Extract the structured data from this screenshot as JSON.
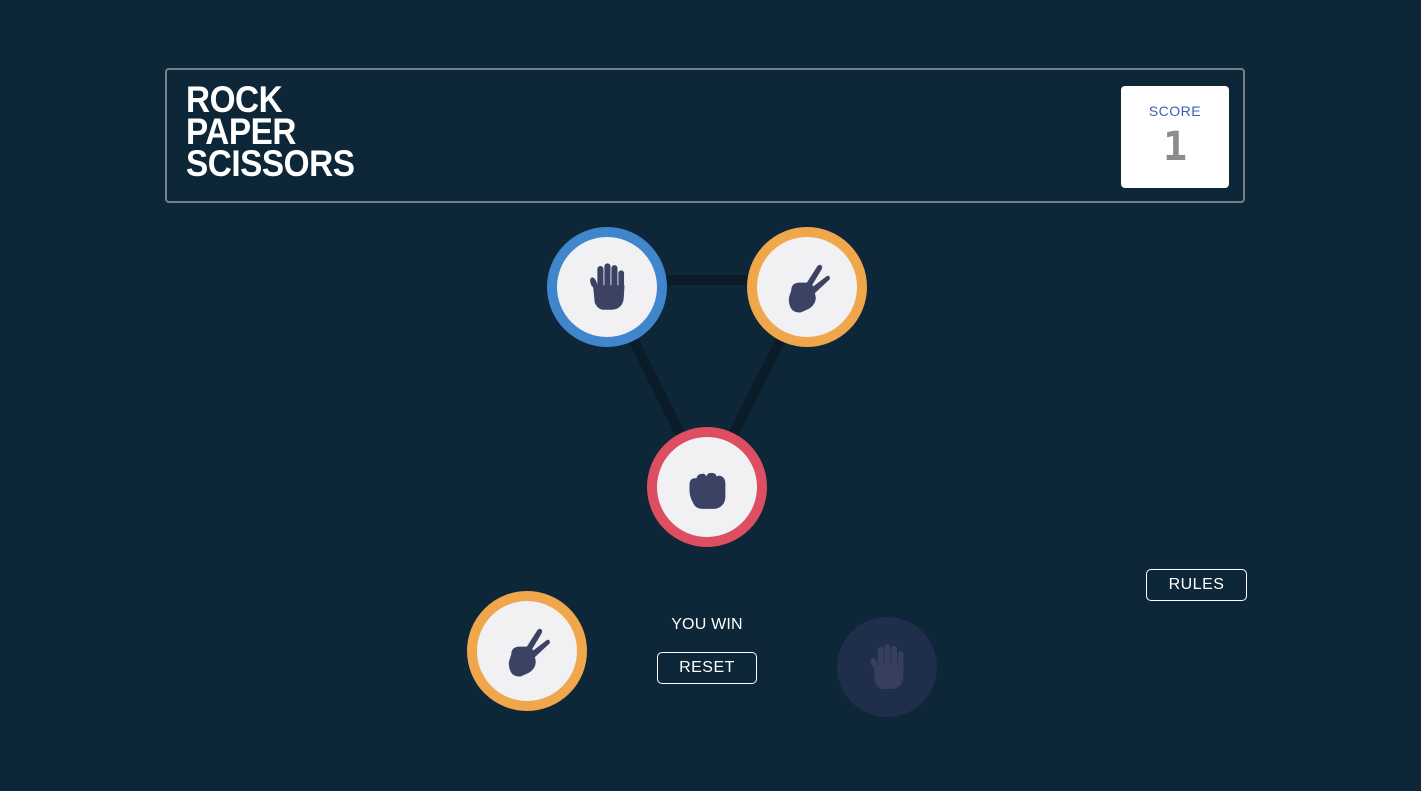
{
  "header": {
    "title_lines": [
      "ROCK",
      "PAPER",
      "SCISSORS"
    ],
    "score_label": "SCORE",
    "score_value": "1"
  },
  "choices": [
    {
      "name": "paper",
      "icon": "paper-hand-icon",
      "ring_color": "#3f86cc"
    },
    {
      "name": "scissors",
      "icon": "scissors-hand-icon",
      "ring_color": "#f0a64a"
    },
    {
      "name": "rock",
      "icon": "rock-fist-icon",
      "ring_color": "#de4e63"
    }
  ],
  "result": {
    "player_pick": "scissors",
    "house_pick": "paper",
    "message": "YOU WIN",
    "reset_label": "RESET"
  },
  "rules_label": "RULES",
  "colors": {
    "background": "#0d2638",
    "paper": "#3f86cc",
    "scissors": "#f0a64a",
    "rock": "#de4e63",
    "icon": "#3b4263"
  }
}
